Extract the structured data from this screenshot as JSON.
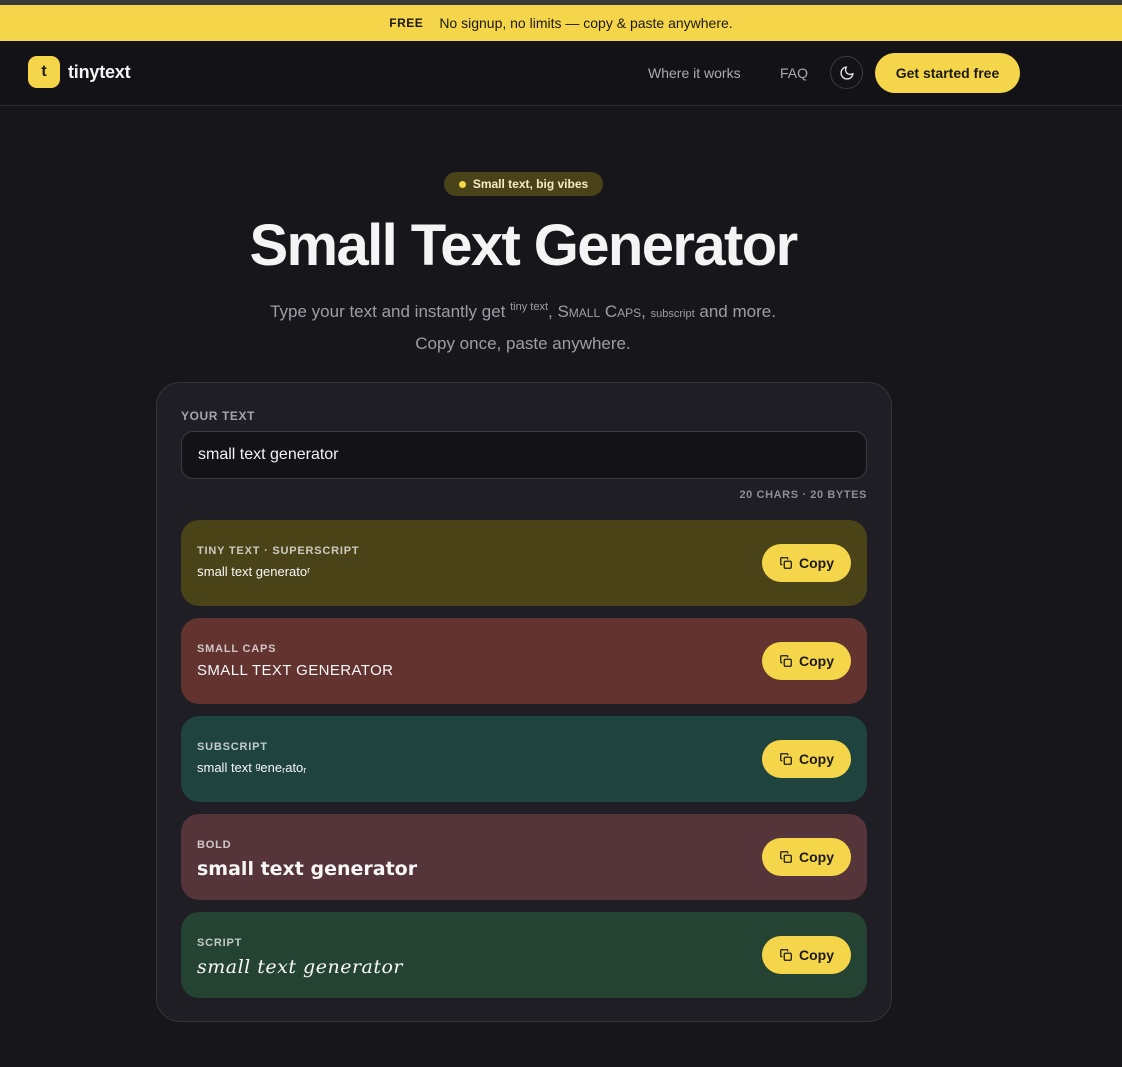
{
  "banner": {
    "tag": "FREE",
    "text": "No signup, no limits — copy & paste anywhere."
  },
  "nav": {
    "logo_mark": "t",
    "logo_text": "tinytext",
    "links": [
      "Where it works",
      "FAQ"
    ],
    "theme_icon": "moon-icon",
    "cta": "Get started free"
  },
  "hero": {
    "pill": "Small text, big vibes",
    "title": "Small Text Generator",
    "subtitle": {
      "p1": "Type your text and instantly get ",
      "tiny": "tiny text",
      "p2": ", ",
      "caps": "Small Caps",
      "p3": ", ",
      "sub": "subscript",
      "p4": " and more.",
      "line2": "Copy once, paste anywhere."
    }
  },
  "editor": {
    "label": "YOUR TEXT",
    "value": "small text generator",
    "counter": "20 CHARS · 20 BYTES"
  },
  "results": [
    {
      "label": "TINY TEXT · SUPERSCRIPT",
      "value": "ꜱmall text generatoʳ",
      "color": "#4b4318"
    },
    {
      "label": "SMALL CAPS",
      "value": "SMALL TEXT GENERATOR",
      "color": "#62332f"
    },
    {
      "label": "SUBSCRIPT",
      "value": "small text ᵍeneᵣatoᵣ",
      "color": "#1f4440"
    },
    {
      "label": "BOLD",
      "value": "small text generator",
      "color": "#55343a"
    },
    {
      "label": "SCRIPT",
      "value": "small text generator",
      "color": "#254333"
    }
  ],
  "copy_label": "Copy",
  "accent": "#f5d64a"
}
